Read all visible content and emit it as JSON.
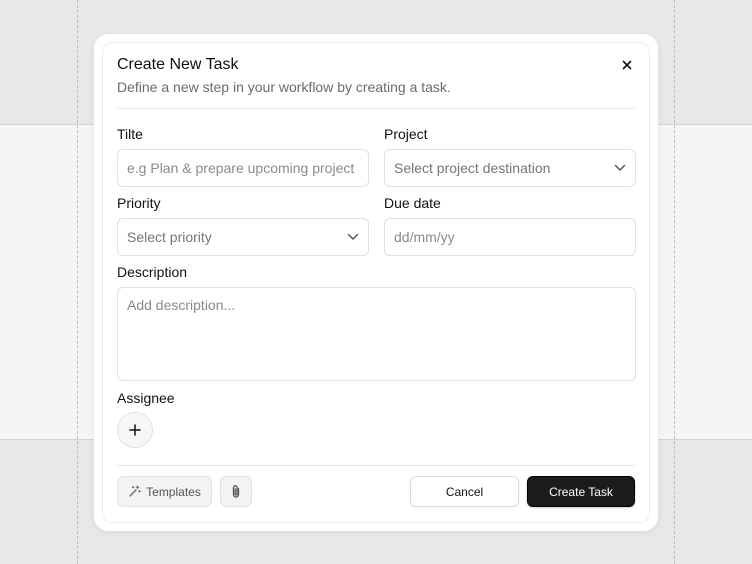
{
  "dialog": {
    "title": "Create New Task",
    "subtitle": "Define a new step in your workflow by creating a task.",
    "close_icon": "close-icon"
  },
  "form": {
    "title": {
      "label": "Tilte",
      "placeholder": "e.g Plan & prepare upcoming project"
    },
    "project": {
      "label": "Project",
      "placeholder": "Select project destination",
      "icon": "chevron-down-icon"
    },
    "priority": {
      "label": "Priority",
      "placeholder": "Select priority",
      "icon": "chevron-down-icon"
    },
    "due_date": {
      "label": "Due date",
      "placeholder": "dd/mm/yy"
    },
    "description": {
      "label": "Description",
      "placeholder": "Add description..."
    },
    "assignee": {
      "label": "Assignee",
      "add_icon": "plus-icon"
    }
  },
  "footer": {
    "templates_label": "Templates",
    "templates_icon": "magic-wand-icon",
    "attach_icon": "paperclip-icon",
    "cancel_label": "Cancel",
    "create_label": "Create Task"
  },
  "colors": {
    "background": "#e8e8e8",
    "primary_button": "#1c1c1c",
    "text": "#111111",
    "muted_text": "#6b6b6b"
  }
}
